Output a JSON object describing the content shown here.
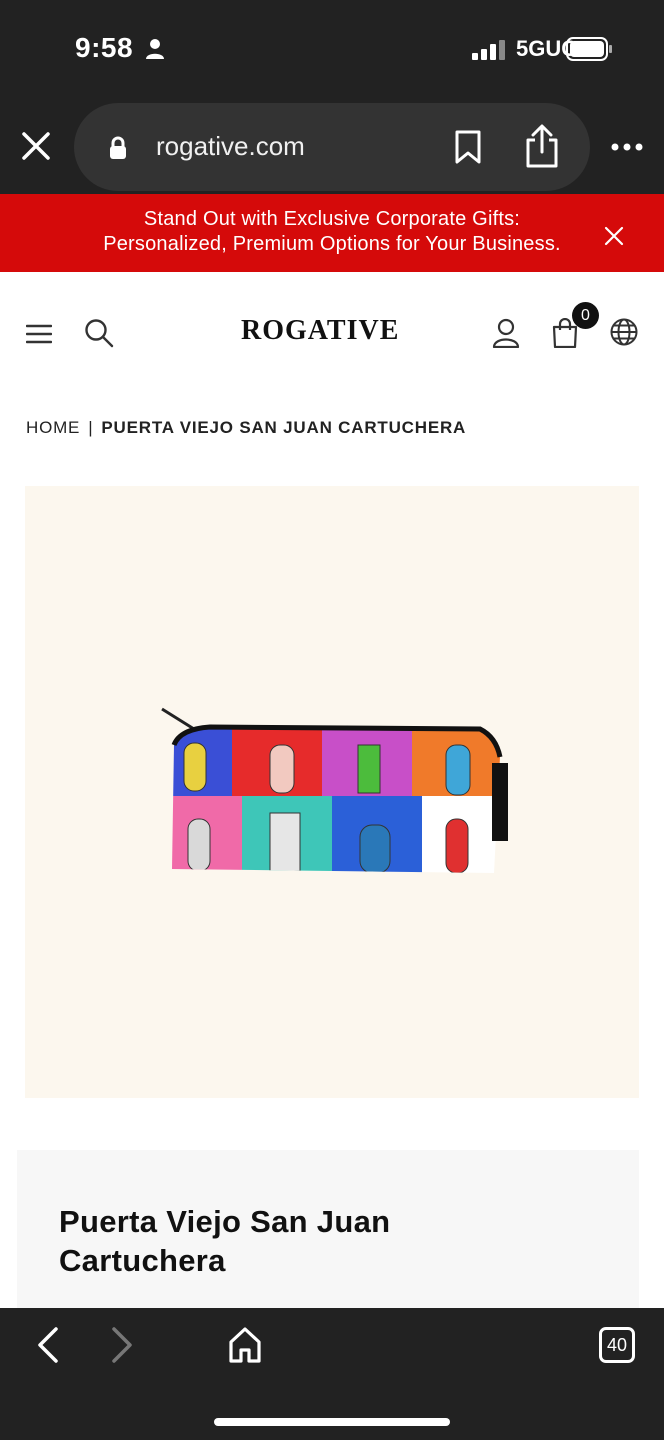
{
  "status_bar": {
    "time": "9:58",
    "network": "5GUC",
    "icons": [
      "person-icon",
      "signal-icon",
      "battery-icon"
    ]
  },
  "browser": {
    "url": "rogative.com",
    "tabs_count": "40",
    "icons": [
      "close-icon",
      "lock-icon",
      "bookmark-icon",
      "share-icon",
      "more-icon",
      "back-icon",
      "forward-icon",
      "home-icon",
      "tabs-icon"
    ]
  },
  "promo": {
    "line1": "Stand Out with Exclusive Corporate Gifts:",
    "line2": "Personalized, Premium Options for Your Business."
  },
  "header": {
    "logo": "ROGATIVE",
    "cart_count": "0",
    "icons": [
      "menu-icon",
      "search-icon",
      "user-icon",
      "cart-icon",
      "globe-icon"
    ]
  },
  "breadcrumb": {
    "home": "HOME",
    "separator": "|",
    "current": "PUERTA VIEJO SAN JUAN CARTUCHERA"
  },
  "product": {
    "title": "Puerta Viejo San Juan Cartuchera",
    "image_bg": "#fcf7ee"
  },
  "colors": {
    "promo_bg": "#d50a0a",
    "browser_bg": "#222222"
  }
}
